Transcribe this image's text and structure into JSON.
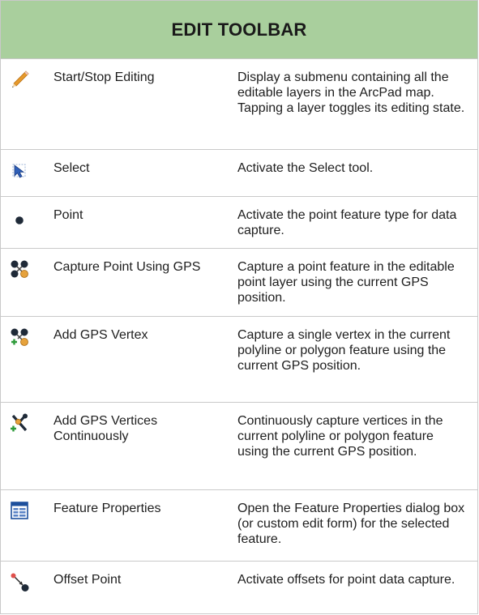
{
  "header": {
    "title": "EDIT TOOLBAR"
  },
  "rows": [
    {
      "icon": "pencil-icon",
      "name": "Start/Stop Editing",
      "desc": "Display a submenu containing all the editable layers in the ArcPad map. Tapping a layer toggles its editing state."
    },
    {
      "icon": "select-arrow-icon",
      "name": "Select",
      "desc": "Activate the Select tool."
    },
    {
      "icon": "point-icon",
      "name": "Point",
      "desc": "Activate the point feature type for data capture."
    },
    {
      "icon": "gps-point-icon",
      "name": "Capture Point Using GPS",
      "desc": "Capture a point feature in the editable point layer using the current GPS position."
    },
    {
      "icon": "gps-vertex-icon",
      "name": "Add GPS Vertex",
      "desc": "Capture a single vertex in the current polyline or polygon feature using the current GPS position."
    },
    {
      "icon": "gps-vertices-continuous-icon",
      "name": "Add GPS Vertices Continuously",
      "desc": "Continuously capture vertices in the current polyline or polygon feature using the current GPS position."
    },
    {
      "icon": "feature-properties-icon",
      "name": "Feature Properties",
      "desc": "Open the Feature Properties dialog box (or custom edit form) for the selected feature."
    },
    {
      "icon": "offset-point-icon",
      "name": "Offset Point",
      "desc": "Activate offsets for point data capture."
    }
  ]
}
